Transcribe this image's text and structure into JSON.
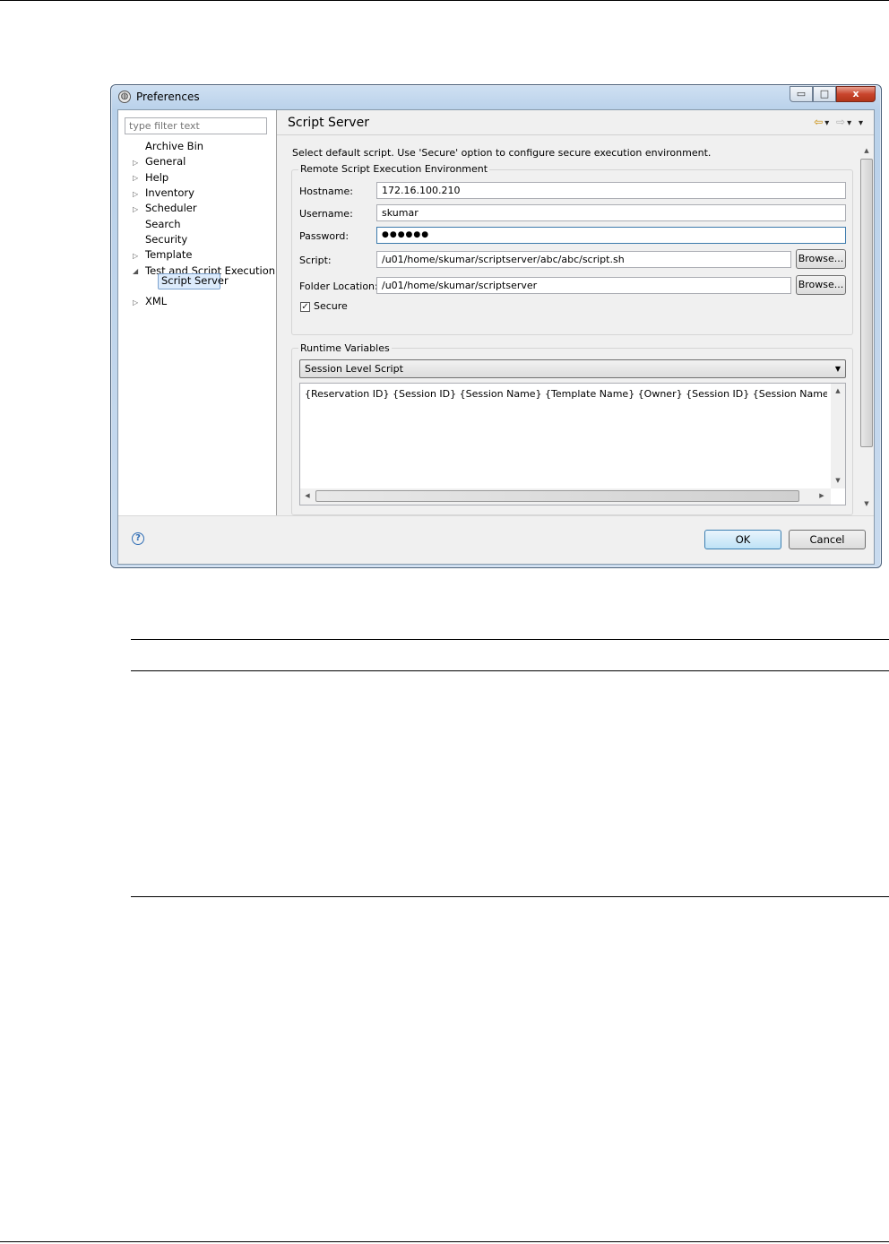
{
  "window": {
    "title": "Preferences",
    "minimize": "▭",
    "maximize": "□",
    "close": "x"
  },
  "filter": {
    "placeholder": "type filter text"
  },
  "tree": {
    "items": [
      {
        "label": "Archive Bin",
        "expander": ""
      },
      {
        "label": "General",
        "expander": "▷"
      },
      {
        "label": "Help",
        "expander": "▷"
      },
      {
        "label": "Inventory",
        "expander": "▷"
      },
      {
        "label": "Scheduler",
        "expander": "▷"
      },
      {
        "label": "Search",
        "expander": ""
      },
      {
        "label": "Security",
        "expander": ""
      },
      {
        "label": "Template",
        "expander": "▷"
      },
      {
        "label": "Test and Script Execution",
        "expander": "◢"
      },
      {
        "label": "Script Server",
        "expander": "",
        "selected": true
      },
      {
        "label": "XML",
        "expander": "▷"
      }
    ]
  },
  "page": {
    "title": "Script Server",
    "description": "Select default script. Use 'Secure' option to configure secure execution environment.",
    "remote_group": "Remote Script Execution Environment",
    "hostname_label": "Hostname:",
    "hostname_value": "172.16.100.210",
    "username_label": "Username:",
    "username_value": "skumar",
    "password_label": "Password:",
    "password_value": "●●●●●●",
    "script_label": "Script:",
    "script_value": "/u01/home/skumar/scriptserver/abc/abc/script.sh",
    "folder_label": "Folder Location:",
    "folder_value": "/u01/home/skumar/scriptserver",
    "browse_label": "Browse...",
    "secure_label": "Secure",
    "secure_checked": true,
    "runtime_group": "Runtime Variables",
    "runtime_select": "Session Level Script",
    "runtime_text": "{Reservation ID} {Session ID} {Session Name} {Template Name} {Owner} {Session ID} {Session Name} {Template Name}"
  },
  "nav": {
    "back": "⇦",
    "forward": "⇨",
    "menu": "▾"
  },
  "dialog": {
    "ok": "OK",
    "cancel": "Cancel",
    "help": "?"
  },
  "colors": {
    "accent": "#3c7fb1",
    "selection": "#dcebfc",
    "title_bar": "#b9d1ea"
  }
}
